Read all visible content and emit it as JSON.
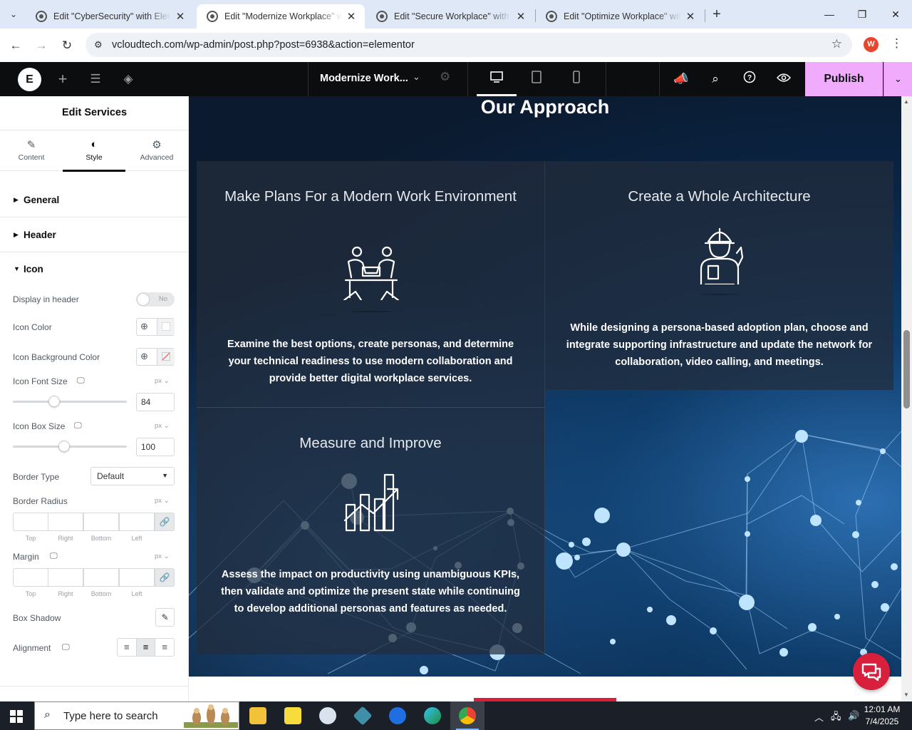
{
  "browser": {
    "tabs": [
      {
        "title": "Edit \"CyberSecurity\" with Elementor",
        "active": false
      },
      {
        "title": "Edit \"Modernize Workplace\" with Elementor",
        "active": true
      },
      {
        "title": "Edit \"Secure Workplace\" with Elementor",
        "active": false
      },
      {
        "title": "Edit \"Optimize Workplace\" with Elementor",
        "active": false
      }
    ],
    "url": "vcloudtech.com/wp-admin/post.php?post=6938&action=elementor",
    "profile_initial": "W"
  },
  "elementor_bar": {
    "logo": "E",
    "document_title": "Modernize Work...",
    "publish_label": "Publish"
  },
  "panel": {
    "title": "Edit Services",
    "tabs": [
      {
        "label": "Content",
        "icon": "pencil-icon"
      },
      {
        "label": "Style",
        "icon": "contrast-icon",
        "active": true
      },
      {
        "label": "Advanced",
        "icon": "gear-icon"
      }
    ],
    "sections": {
      "general": "General",
      "header": "Header",
      "icon": "Icon"
    },
    "controls": {
      "display_in_header": {
        "label": "Display in header",
        "value": "No"
      },
      "icon_color": {
        "label": "Icon Color"
      },
      "icon_bg_color": {
        "label": "Icon Background Color"
      },
      "icon_font_size": {
        "label": "Icon Font Size",
        "unit": "px",
        "value": "84",
        "level": 0.36
      },
      "icon_box_size": {
        "label": "Icon Box Size",
        "unit": "px",
        "value": "100",
        "level": 0.45
      },
      "border_type": {
        "label": "Border Type",
        "value": "Default"
      },
      "border_radius": {
        "label": "Border Radius",
        "unit": "px"
      },
      "margin": {
        "label": "Margin",
        "unit": "px"
      },
      "box_shadow": {
        "label": "Box Shadow"
      },
      "alignment": {
        "label": "Alignment"
      }
    },
    "dimension_labels": [
      "Top",
      "Right",
      "Bottom",
      "Left"
    ]
  },
  "canvas": {
    "section_title": "Our Approach",
    "services": [
      {
        "heading": "Make Plans For a Modern Work Environment",
        "icon": "meeting-people-icon",
        "description": "Examine the best options, create personas, and determine your technical readiness to use modern collaboration and provide better digital workplace services."
      },
      {
        "heading": "Create a Whole Architecture",
        "icon": "engineer-icon",
        "description": "While designing a persona-based adoption plan, choose and integrate supporting infrastructure and update the network for collaboration, video calling, and meetings."
      },
      {
        "heading": "Measure and Improve",
        "icon": "growth-chart-icon",
        "description": "Assess the impact on productivity using unambiguous KPIs, then validate and optimize the present state while continuing to develop additional personas and features as needed."
      }
    ]
  },
  "taskbar": {
    "search_placeholder": "Type here to search",
    "time": "12:01 AM",
    "date": "7/4/2025",
    "apps": [
      "file-explorer-icon",
      "sticky-notes-icon",
      "paint-icon",
      "app-icon",
      "zoom-icon",
      "edge-icon",
      "chrome-icon"
    ]
  },
  "colors": {
    "publish_bg": "#f0abfc",
    "elementor_bar": "#0c0d0e",
    "chat_button": "#d81f3c"
  }
}
